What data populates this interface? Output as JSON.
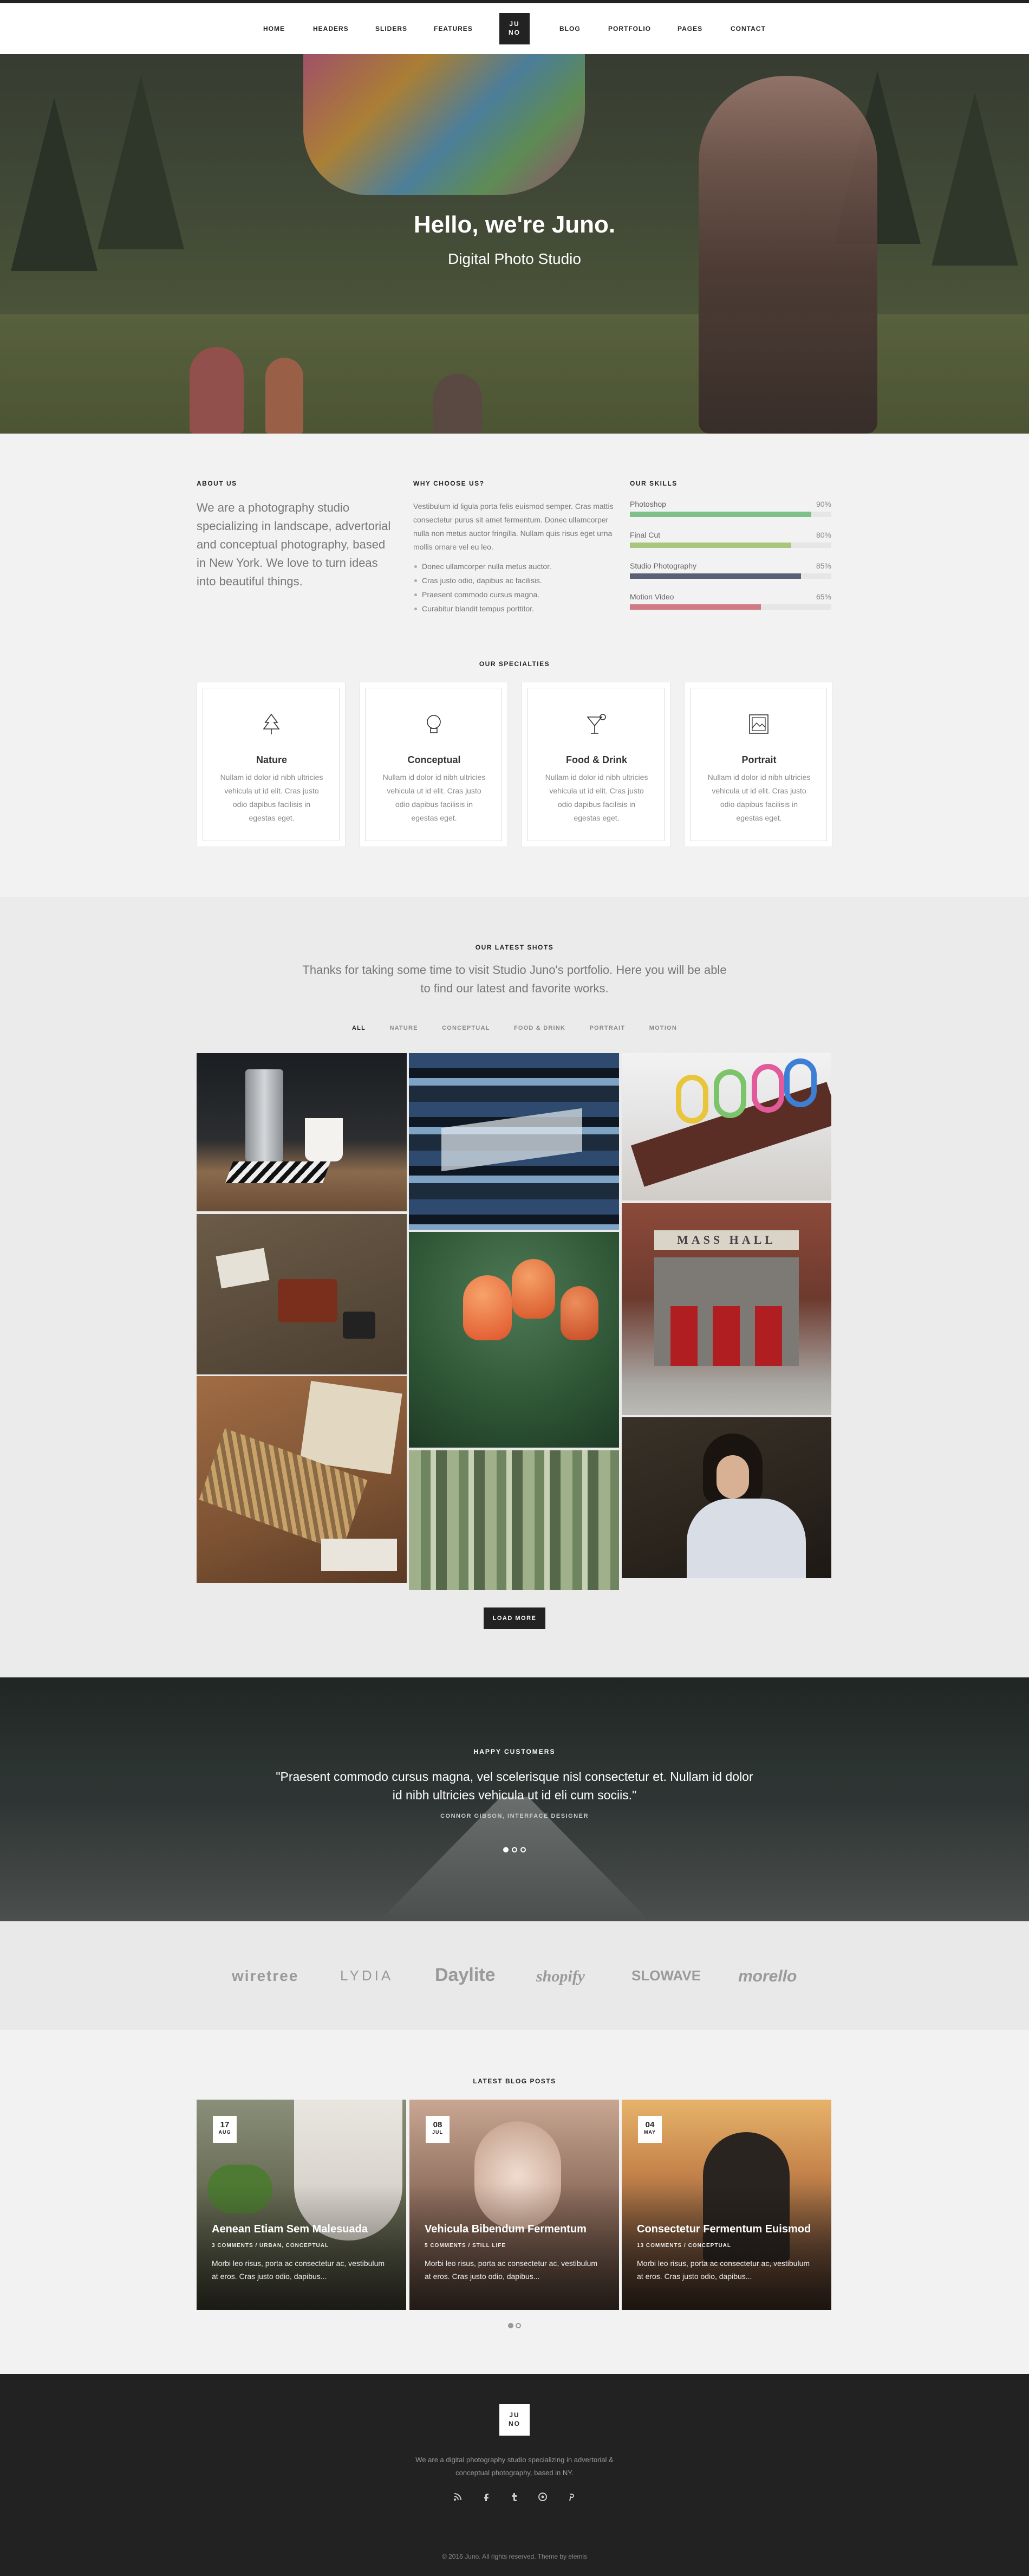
{
  "nav": {
    "items": [
      "HOME",
      "HEADERS",
      "SLIDERS",
      "FEATURES",
      "BLOG",
      "PORTFOLIO",
      "PAGES",
      "CONTACT"
    ],
    "logo_lines": [
      "JU",
      "NO"
    ]
  },
  "hero": {
    "title": "Hello, we're Juno.",
    "subtitle": "Digital Photo Studio"
  },
  "about": {
    "label": "ABOUT US",
    "text": "We are a photography studio specializing in landscape, advertorial and conceptual photography, based in New York. We love to turn ideas into beautiful things."
  },
  "why": {
    "label": "WHY CHOOSE US?",
    "text": "Vestibulum id ligula porta felis euismod semper. Cras mattis consectetur purus sit amet fermentum. Donec ullamcorper nulla non metus auctor fringilla. Nullam quis risus eget urna mollis ornare vel eu leo.",
    "list": [
      "Donec ullamcorper nulla metus auctor.",
      "Cras justo odio, dapibus ac facilisis.",
      "Praesent commodo cursus magna.",
      "Curabitur blandit tempus porttitor."
    ]
  },
  "skills": {
    "label": "OUR SKILLS",
    "items": [
      {
        "name": "Photoshop",
        "percent": "90%",
        "value": 90,
        "color": "#7ec08a"
      },
      {
        "name": "Final Cut",
        "percent": "80%",
        "value": 80,
        "color": "#a9c77c"
      },
      {
        "name": "Studio Photography",
        "percent": "85%",
        "value": 85,
        "color": "#5a6176"
      },
      {
        "name": "Motion Video",
        "percent": "65%",
        "value": 65,
        "color": "#d07a86"
      }
    ]
  },
  "specialties": {
    "label": "OUR SPECIALTIES",
    "cards": [
      {
        "title": "Nature",
        "icon": "tree-icon",
        "text": "Nullam id dolor id nibh ultricies vehicula ut id elit. Cras justo odio dapibus facilisis in egestas eget."
      },
      {
        "title": "Conceptual",
        "icon": "lightbulb-icon",
        "text": "Nullam id dolor id nibh ultricies vehicula ut id elit. Cras justo odio dapibus facilisis in egestas eget."
      },
      {
        "title": "Food & Drink",
        "icon": "cocktail-icon",
        "text": "Nullam id dolor id nibh ultricies vehicula ut id elit. Cras justo odio dapibus facilisis in egestas eget."
      },
      {
        "title": "Portrait",
        "icon": "picture-icon",
        "text": "Nullam id dolor id nibh ultricies vehicula ut id elit. Cras justo odio dapibus facilisis in egestas eget."
      }
    ]
  },
  "portfolio": {
    "label": "OUR LATEST SHOTS",
    "intro": "Thanks for taking some time to visit Studio Juno's portfolio. Here you will be able to find our latest and favorite works.",
    "filters": [
      "ALL",
      "NATURE",
      "CONCEPTUAL",
      "FOOD & DRINK",
      "PORTRAIT",
      "MOTION"
    ],
    "active_filter": "ALL",
    "sign_text": "MASS HALL",
    "load_more": "LOAD MORE"
  },
  "testimonial": {
    "label": "HAPPY CUSTOMERS",
    "quote": "\"Praesent commodo cursus magna, vel scelerisque nisl consectetur et. Nullam id dolor id nibh ultricies vehicula ut id eli cum sociis.\"",
    "author": "CONNOR GIBSON, INTERFACE DESIGNER"
  },
  "clients": [
    "wiretree",
    "LYDIA",
    "Daylite",
    "shopify",
    "SLOWAVE",
    "morello"
  ],
  "blog": {
    "label": "LATEST BLOG POSTS",
    "posts": [
      {
        "day": "17",
        "month": "AUG",
        "title": "Aenean Etiam Sem Malesuada",
        "meta": "3 COMMENTS  /  URBAN, CONCEPTUAL",
        "excerpt": "Morbi leo risus, porta ac consectetur ac, vestibulum at eros. Cras justo odio, dapibus..."
      },
      {
        "day": "08",
        "month": "JUL",
        "title": "Vehicula Bibendum Fermentum",
        "meta": "5 COMMENTS  /  STILL LIFE",
        "excerpt": "Morbi leo risus, porta ac consectetur ac, vestibulum at eros. Cras justo odio, dapibus..."
      },
      {
        "day": "04",
        "month": "MAY",
        "title": "Consectetur Fermentum Euismod",
        "meta": "13 COMMENTS  /  CONCEPTUAL",
        "excerpt": "Morbi leo risus, porta ac consectetur ac, vestibulum at eros. Cras justo odio, dapibus..."
      }
    ]
  },
  "footer": {
    "logo_lines": [
      "JU",
      "NO"
    ],
    "text": "We are a digital photography studio specializing in advertorial & conceptual photography, based in NY.",
    "social": [
      "rss-icon",
      "facebook-icon",
      "tumblr-icon",
      "pinterest-icon",
      "pinterest-p-icon"
    ],
    "copyright": "© 2016 Juno. All rights reserved. Theme by elemis"
  }
}
